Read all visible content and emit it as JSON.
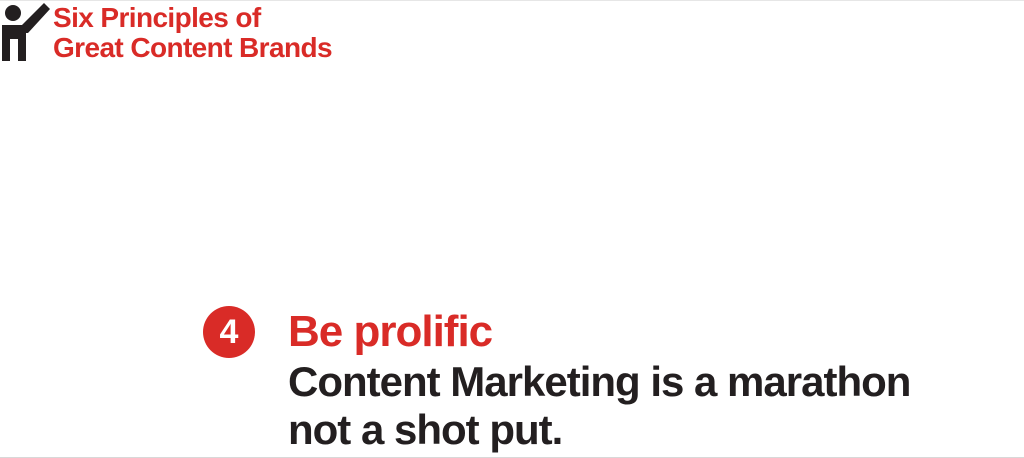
{
  "header": {
    "line1": "Six Principles of",
    "line2": "Great Content Brands"
  },
  "logo": {
    "icon": "person-raising-hand-icon"
  },
  "principle": {
    "number": "4",
    "title": "Be prolific",
    "body_line1": "Content Marketing is a marathon",
    "body_line2": "not a shot put."
  },
  "colors": {
    "accent": "#d92b27",
    "text": "#231f20",
    "background": "#ffffff"
  }
}
